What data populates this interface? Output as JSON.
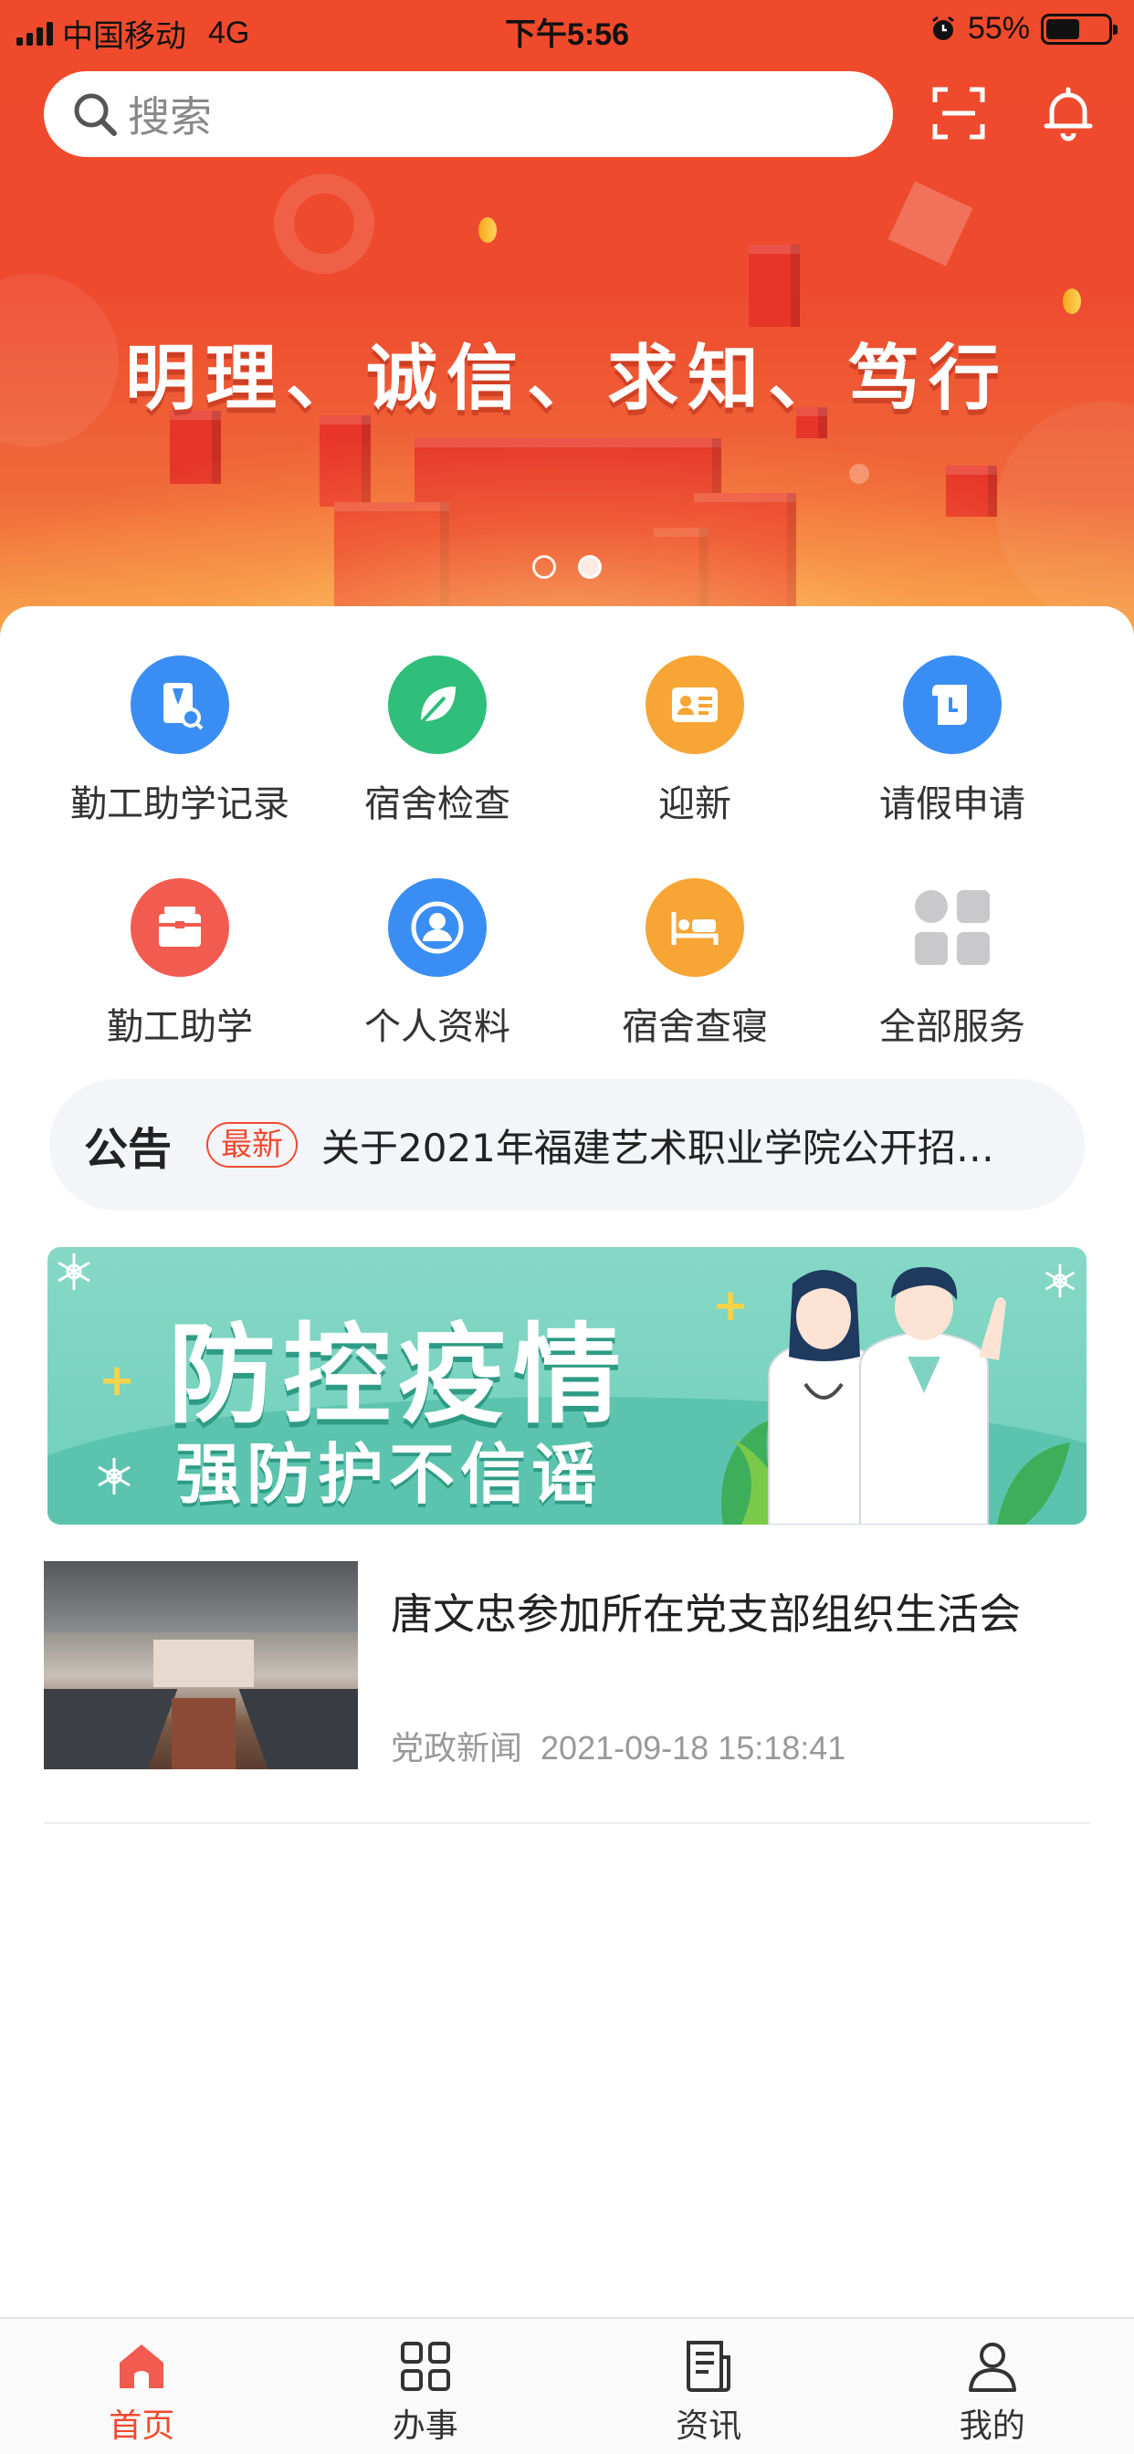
{
  "status_bar": {
    "carrier": "中国移动",
    "network": "4G",
    "time": "下午5:56",
    "battery_percent": "55%",
    "battery_level": 0.55
  },
  "header": {
    "search_placeholder": "搜索",
    "scan_icon": "scan-icon",
    "bell_icon": "bell-icon"
  },
  "hero": {
    "slogan": "明理、诚信、求知、笃行",
    "slide_count": 2,
    "active_slide": 2
  },
  "services": [
    {
      "label": "勤工助学记录",
      "icon": "record-icon",
      "color": "#3a8ef3"
    },
    {
      "label": "宿舍检查",
      "icon": "leaf-icon",
      "color": "#2fbf7a"
    },
    {
      "label": "迎新",
      "icon": "id-card-icon",
      "color": "#f7a534"
    },
    {
      "label": "请假申请",
      "icon": "leave-icon",
      "color": "#3a8ef3"
    },
    {
      "label": "勤工助学",
      "icon": "briefcase-icon",
      "color": "#f25b4f"
    },
    {
      "label": "个人资料",
      "icon": "user-icon",
      "color": "#3a8ef3"
    },
    {
      "label": "宿舍查寝",
      "icon": "bed-icon",
      "color": "#f7a534"
    },
    {
      "label": "全部服务",
      "icon": "grid-icon",
      "color": "#c9c9cb"
    }
  ],
  "notice": {
    "tag": "公告",
    "badge": "最新",
    "text": "关于2021年福建艺术职业学院公开招…"
  },
  "banner": {
    "title": "防控疫情",
    "subtitle": "强防护不信谣"
  },
  "news": [
    {
      "title": "唐文忠参加所在党支部组织生活会",
      "category": "党政新闻",
      "datetime": "2021-09-18 15:18:41"
    }
  ],
  "tabs": [
    {
      "label": "首页",
      "icon": "home-icon",
      "active": true
    },
    {
      "label": "办事",
      "icon": "apps-icon",
      "active": false
    },
    {
      "label": "资讯",
      "icon": "news-icon",
      "active": false
    },
    {
      "label": "我的",
      "icon": "profile-icon",
      "active": false
    }
  ],
  "colors": {
    "brand": "#ef4a2f",
    "hero_top": "#f04a2c",
    "banner_teal": "#6fcfbb"
  }
}
